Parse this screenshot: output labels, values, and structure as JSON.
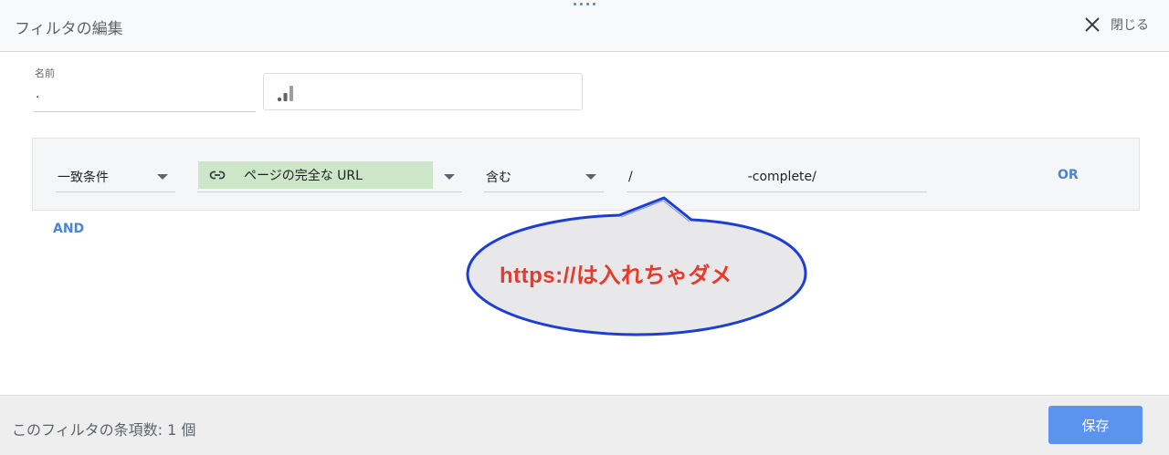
{
  "header": {
    "title": "フィルタの編集",
    "close_label": "閉じる"
  },
  "form": {
    "name_label": "名前",
    "name_value": "."
  },
  "condition": {
    "match_type": "一致条件",
    "dimension": "ページの完全な URL",
    "operator": "含む",
    "value_prefix": "/",
    "value_suffix": "-complete/",
    "or_label": "OR"
  },
  "and_label": "AND",
  "annotation": {
    "text": "https://は入れちゃダメ"
  },
  "footer": {
    "count_text": "このフィルタの条項数: 1 個",
    "save_label": "保存"
  },
  "icons": {
    "close": "close-icon",
    "signal": "signal-bars-icon",
    "link": "link-icon",
    "caret": "caret-down-icon"
  },
  "colors": {
    "accent": "#4a86d4",
    "chip_bg": "#cde6c8",
    "save_bg": "#5b93ee",
    "annotation_text": "#e8392a",
    "annotation_border": "#1b3fd6"
  }
}
